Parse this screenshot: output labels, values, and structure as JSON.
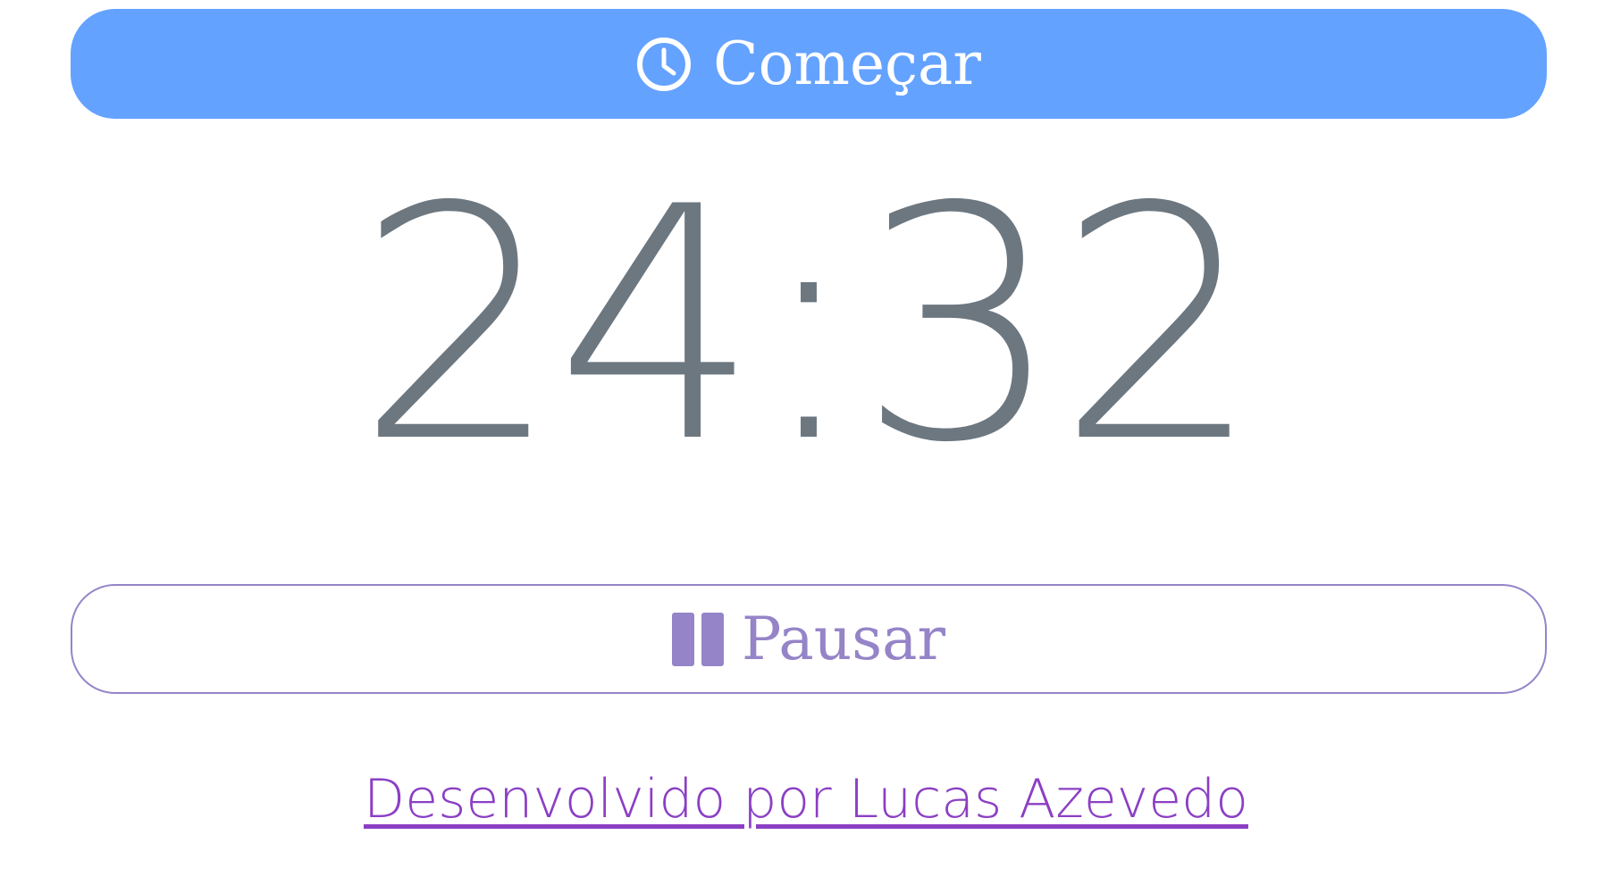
{
  "start_button": {
    "label": "Começar",
    "icon": "clock-icon",
    "color": "#64a2ff"
  },
  "timer": {
    "display": "24:32"
  },
  "pause_button": {
    "label": "Pausar",
    "icon": "pause-icon",
    "color": "#9584c8"
  },
  "footer": {
    "credit_link": "Desenvolvido por Lucas Azevedo",
    "link_color": "#8b3fc4"
  }
}
